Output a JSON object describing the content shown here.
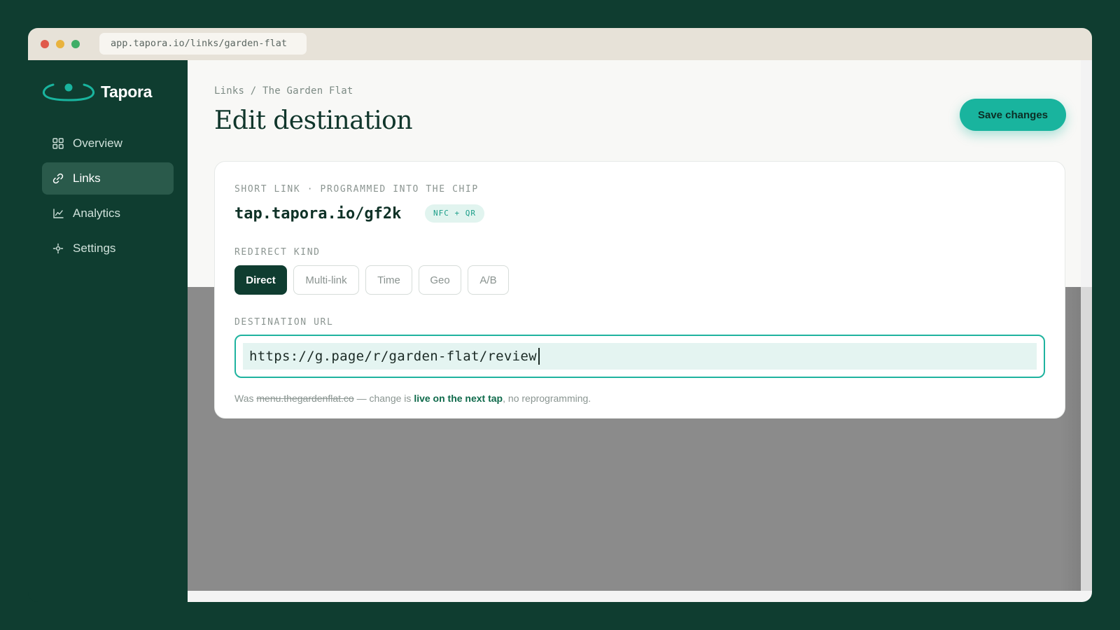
{
  "browser": {
    "url": "app.tapora.io/links/garden-flat"
  },
  "brand": {
    "name": "Tapora",
    "accent": "#19b49e"
  },
  "sidebar": {
    "items": [
      {
        "label": "Overview",
        "icon": "grid-icon",
        "active": false
      },
      {
        "label": "Links",
        "icon": "link-icon",
        "active": true
      },
      {
        "label": "Analytics",
        "icon": "chart-icon",
        "active": false
      },
      {
        "label": "Settings",
        "icon": "gear-icon",
        "active": false
      }
    ]
  },
  "header": {
    "breadcrumb": "Links / The Garden Flat",
    "title": "Edit destination",
    "save_label": "Save changes"
  },
  "card": {
    "short_link_label": "SHORT LINK · PROGRAMMED INTO THE CHIP",
    "short_link": "tap.tapora.io/gf2k",
    "badge": "NFC + QR",
    "redirect_label": "REDIRECT KIND",
    "redirect_options": [
      "Direct",
      "Multi-link",
      "Time",
      "Geo",
      "A/B"
    ],
    "redirect_selected": "Direct",
    "destination_label": "DESTINATION URL",
    "destination_value": "https://g.page/r/garden-flat/review",
    "hint": {
      "prefix": "Was ",
      "old_url": "menu.thegardenflat.co",
      "middle": " — change is ",
      "emphasis": "live on the next tap",
      "suffix": ", no reprogramming."
    }
  },
  "colors": {
    "background": "#0f3d30",
    "sidebar_active": "#2a5a4b",
    "primary_button": "#19b49e",
    "selected_segment": "#0f3d30"
  }
}
